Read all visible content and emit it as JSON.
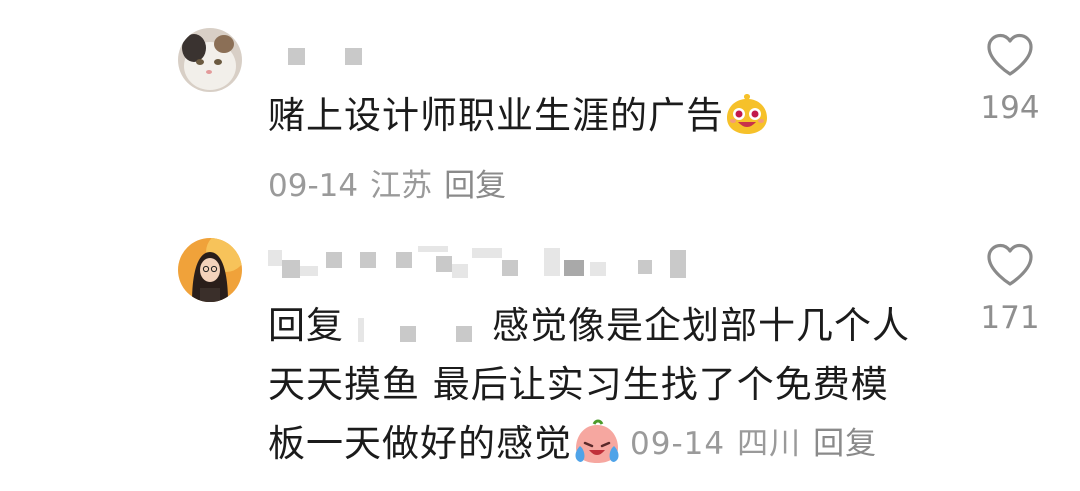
{
  "comments": [
    {
      "text": "赌上设计师职业生涯的广告",
      "emoji": "grinning-yellow-emoji",
      "date": "09-14",
      "location": "江苏",
      "reply_label": "回复",
      "likes": "194"
    },
    {
      "reply_prefix": "回复",
      "text_line1": "感觉像是企划部十几个人",
      "text_line2": "天天摸鱼  最后让实习生找了个免费模",
      "text_line3": "板一天做好的感觉",
      "emoji": "crying-laughing-emoji",
      "date": "09-14",
      "location": "四川",
      "reply_label": "回复",
      "likes": "171"
    }
  ],
  "icons": {
    "like": "heart-outline-icon"
  },
  "colors": {
    "text": "#1b1b1b",
    "meta": "#9a9a9a",
    "count": "#8f8f8f"
  }
}
